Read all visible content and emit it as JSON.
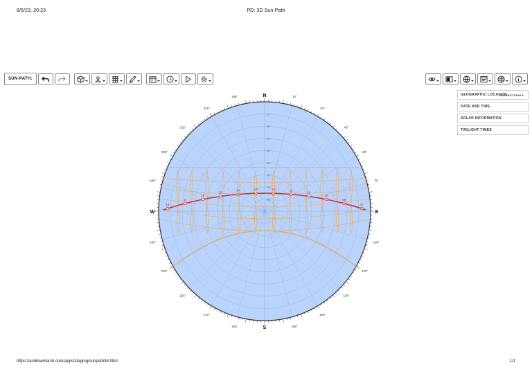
{
  "header": {
    "datetime": "8/5/23, 20:23",
    "title": "PD: 3D Sun-Path"
  },
  "footer": {
    "url": "https://andrewmarsh.com/apps/staging/sunpath3d.html",
    "page": "1/1"
  },
  "toolbar": {
    "label": "SUN-PATH:",
    "left_icons": [
      "undo-icon",
      "redo-icon",
      "cube-icon",
      "sun-tilt-icon",
      "grid-icon",
      "pen-icon",
      "calendar-icon",
      "clock-icon",
      "play-icon",
      "gear-icon"
    ],
    "right_icons": [
      "eye-icon",
      "display-icon",
      "globe-icon",
      "dialog-icon",
      "world-icon",
      "info-icon"
    ]
  },
  "panel": {
    "geographic_location": "GEOGRAPHIC LOCATION",
    "location_sub": "SUGGESTIONS",
    "date_and_time": "DATE AND TIME",
    "solar_information": "SOLAR INFORMATION",
    "twilight_times": "TWILIGHT TIMES"
  },
  "sunpath": {
    "cardinals": {
      "n": "N",
      "s": "S",
      "e": "E",
      "w": "W"
    },
    "azimuth_labels": [
      "15°",
      "30°",
      "45°",
      "60°",
      "75°",
      "105°",
      "120°",
      "135°",
      "150°",
      "165°",
      "195°",
      "210°",
      "225°",
      "240°",
      "255°",
      "285°",
      "300°",
      "315°",
      "330°",
      "345°"
    ],
    "altitude_labels": [
      "80°",
      "70°",
      "60°",
      "50°",
      "40°",
      "30°",
      "20°",
      "10°"
    ],
    "hour_labels": [
      "18",
      "17",
      "16",
      "15",
      "14",
      "13",
      "12",
      "11",
      "10",
      "09",
      "08",
      "07"
    ],
    "colors": {
      "sky": "#b9d3fb",
      "rim": "#333333",
      "grid": "#7f9fc8",
      "analemma": "#f0a54c",
      "sun_path": "#d42a2a"
    }
  }
}
